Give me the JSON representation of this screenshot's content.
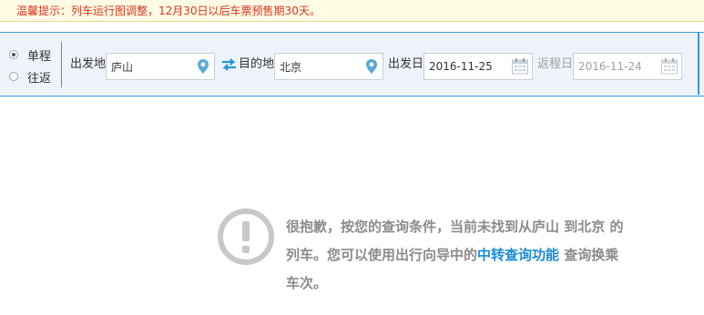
{
  "notice": {
    "label": "温馨提示：",
    "text": "列车运行图调整，12月30日以后车票预售期30天。"
  },
  "trip_type": {
    "options": [
      {
        "label": "单程",
        "selected": true
      },
      {
        "label": "往返",
        "selected": false
      }
    ]
  },
  "search": {
    "from_label": "出发地",
    "from_value": "庐山",
    "to_label": "目的地",
    "to_value": "北京",
    "depart_label": "出发日",
    "depart_value": "2016-11-25",
    "return_label": "返程日",
    "return_value": "2016-11-24"
  },
  "result": {
    "line1": "很抱歉，按您的查询条件，当前未找到从庐山 到北京 的",
    "line2_prefix": "列车。您可以使用出行向导中的",
    "link_text": "中转查询功能",
    "line2_suffix": " 查询换乘",
    "line3": "车次。"
  },
  "colors": {
    "accent": "#3b99d6",
    "notice_text": "#d9361e",
    "link": "#1a8cd8",
    "muted_text": "#8c8c8c"
  },
  "icons": {
    "location": "location-pin-icon",
    "swap": "swap-arrows-icon",
    "calendar": "calendar-icon",
    "warning": "exclamation-circle-icon"
  }
}
